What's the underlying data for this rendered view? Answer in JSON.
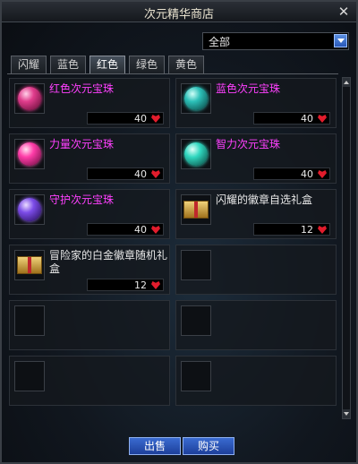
{
  "window": {
    "title": "次元精华商店"
  },
  "filter": {
    "selected": "全部"
  },
  "tabs": [
    {
      "label": "闪耀",
      "active": false
    },
    {
      "label": "蓝色",
      "active": false
    },
    {
      "label": "红色",
      "active": true
    },
    {
      "label": "绿色",
      "active": false
    },
    {
      "label": "黄色",
      "active": false
    }
  ],
  "items": [
    {
      "name": "红色次元宝珠",
      "price": "40",
      "name_color": "#ff40ff",
      "icon": "red-gem-icon"
    },
    {
      "name": "蓝色次元宝珠",
      "price": "40",
      "name_color": "#ff40ff",
      "icon": "blue-gem-icon"
    },
    {
      "name": "力量次元宝珠",
      "price": "40",
      "name_color": "#ff40ff",
      "icon": "pink-gem-icon"
    },
    {
      "name": "智力次元宝珠",
      "price": "40",
      "name_color": "#ff40ff",
      "icon": "teal-gem-icon"
    },
    {
      "name": "守护次元宝珠",
      "price": "40",
      "name_color": "#ff40ff",
      "icon": "purple-gem-icon"
    },
    {
      "name": "闪耀的徽章自选礼盒",
      "price": "12",
      "name_color": "#e8e8e8",
      "icon": "gift-box-icon"
    },
    {
      "name": "冒险家的白金徽章随机礼盒",
      "price": "12",
      "name_color": "#e8e8e8",
      "icon": "gift-box-icon"
    }
  ],
  "currency_icon": "heart-icon",
  "buttons": {
    "sell": "出售",
    "buy": "购买"
  },
  "colors": {
    "accent": "#3a6bd0",
    "heart": "#e21c2c",
    "rare_item": "#ff40ff"
  }
}
